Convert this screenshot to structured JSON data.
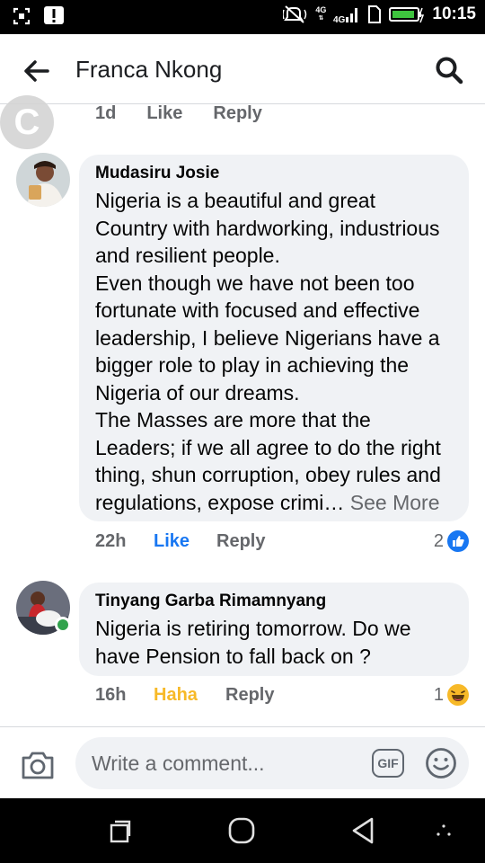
{
  "status_bar": {
    "time": "10:15",
    "network_top": "4G",
    "network_label": "4G",
    "icons": [
      "screenshot-icon",
      "alert-icon",
      "mute-icon",
      "signal-icon",
      "sim-icon",
      "battery-icon"
    ]
  },
  "header": {
    "title": "Franca Nkong",
    "back_icon": "arrow-left-icon",
    "search_icon": "search-icon"
  },
  "watermark": {
    "letter": "C"
  },
  "previous_comment": {
    "time": "1d",
    "like_label": "Like",
    "reply_label": "Reply"
  },
  "comments": [
    {
      "author": "Mudasiru Josie",
      "text": "Nigeria is a beautiful and great Country with hardworking, industrious and resilient people.\nEven though we have not been too fortunate with focused and effective leadership,  I believe Nigerians have a bigger role to play in achieving the Nigeria of our dreams.\nThe Masses are more that the Leaders; if we all agree to do the right thing, shun corruption, obey rules and regulations, expose crimi…",
      "see_more": "See More",
      "time": "22h",
      "like_label": "Like",
      "reply_label": "Reply",
      "reaction_count": "2",
      "reaction_type": "like",
      "online": false
    },
    {
      "author": "Tinyang Garba Rimamnyang",
      "text": "Nigeria is retiring tomorrow. Do we have Pension to fall back on ?",
      "time": "16h",
      "like_label": "Haha",
      "reply_label": "Reply",
      "reaction_count": "1",
      "reaction_type": "haha",
      "online": true
    }
  ],
  "composer": {
    "placeholder": "Write a comment...",
    "gif_label": "GIF",
    "camera_icon": "camera-icon",
    "emoji_icon": "emoji-icon"
  },
  "nav_bar": {
    "icons": [
      "recents-icon",
      "home-icon",
      "back-icon",
      "menu-icon"
    ]
  },
  "colors": {
    "like_blue": "#1877f2",
    "haha_yellow": "#f7b928",
    "secondary_text": "#65676b",
    "bubble_bg": "#f0f2f5",
    "online_green": "#31a24c"
  }
}
